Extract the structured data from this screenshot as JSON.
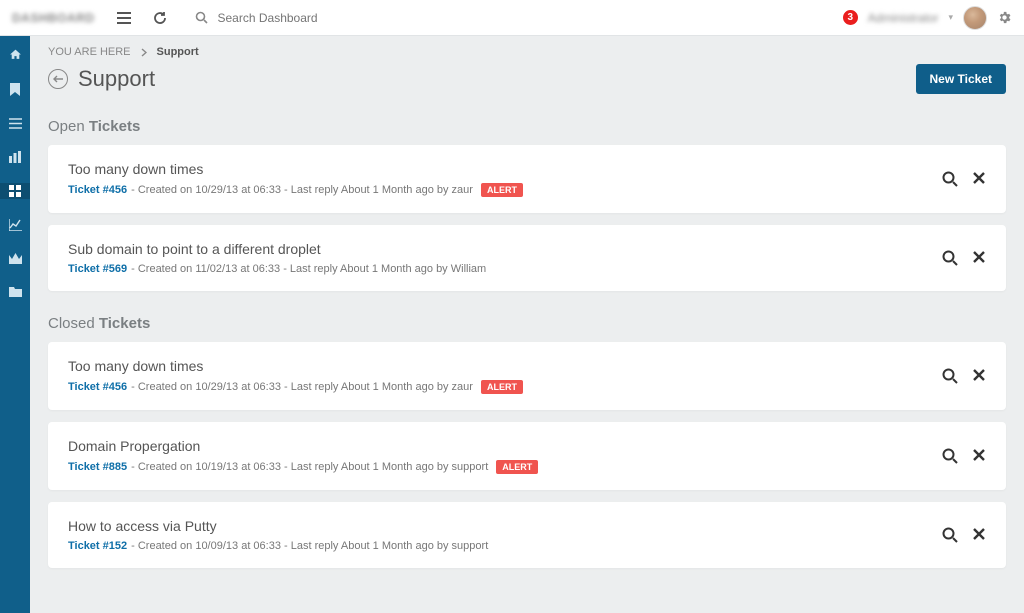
{
  "header": {
    "logo_text": "DASHBOARD",
    "search_placeholder": "Search Dashboard",
    "notification_count": "3",
    "user_display_name": "Administrator"
  },
  "breadcrumb": {
    "prefix": "YOU ARE HERE",
    "current": "Support"
  },
  "page": {
    "title": "Support",
    "new_ticket_label": "New Ticket"
  },
  "sections": {
    "open_prefix": "Open ",
    "open_bold": "Tickets",
    "closed_prefix": "Closed ",
    "closed_bold": "Tickets"
  },
  "tickets": {
    "open": [
      {
        "title": "Too many down times",
        "id_label": "Ticket #456",
        "meta": " - Created on 10/29/13 at 06:33 - Last reply About 1 Month ago by zaur",
        "alert": "ALERT"
      },
      {
        "title": "Sub domain to point to a different droplet",
        "id_label": "Ticket #569",
        "meta": " - Created on 11/02/13 at 06:33 - Last reply About 1 Month ago by William",
        "alert": ""
      }
    ],
    "closed": [
      {
        "title": "Too many down times",
        "id_label": "Ticket #456",
        "meta": " - Created on 10/29/13 at 06:33 - Last reply About 1 Month ago by zaur",
        "alert": "ALERT"
      },
      {
        "title": "Domain Propergation",
        "id_label": "Ticket #885",
        "meta": " - Created on 10/19/13 at 06:33 - Last reply About 1 Month ago by support",
        "alert": "ALERT"
      },
      {
        "title": "How to access via Putty",
        "id_label": "Ticket #152",
        "meta": " - Created on 10/09/13 at 06:33 - Last reply About 1 Month ago by support",
        "alert": ""
      }
    ]
  }
}
